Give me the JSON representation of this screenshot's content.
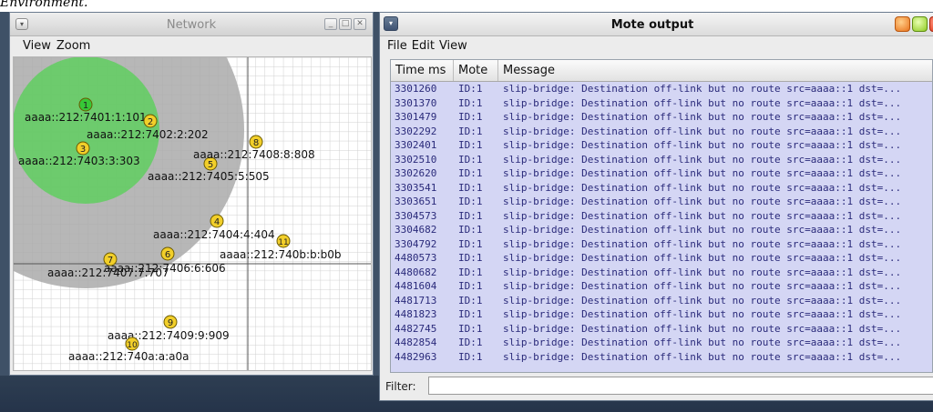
{
  "network": {
    "title": "Network",
    "menu": [
      "View",
      "Zoom"
    ],
    "motes": [
      {
        "id": "1",
        "color": "#37c837",
        "addr": "aaaa::212:7401:1:101"
      },
      {
        "id": "2",
        "color": "#f2cf2a",
        "addr": "aaaa::212:7402:2:202"
      },
      {
        "id": "3",
        "color": "#f2cf2a",
        "addr": "aaaa::212:7403:3:303"
      },
      {
        "id": "4",
        "color": "#f2cf2a",
        "addr": "aaaa::212:7404:4:404"
      },
      {
        "id": "5",
        "color": "#f2cf2a",
        "addr": "aaaa::212:7405:5:505"
      },
      {
        "id": "6",
        "color": "#f2cf2a",
        "addr": "aaaa::212:7406:6:606"
      },
      {
        "id": "7",
        "color": "#f2cf2a",
        "addr": "aaaa::212:7407:7:707"
      },
      {
        "id": "8",
        "color": "#f2cf2a",
        "addr": "aaaa::212:7408:8:808"
      },
      {
        "id": "9",
        "color": "#f2cf2a",
        "addr": "aaaa::212:7409:9:909"
      },
      {
        "id": "10",
        "color": "#f2cf2a",
        "addr": "aaaa::212:740a:a:a0a"
      },
      {
        "id": "11",
        "color": "#f2cf2a",
        "addr": "aaaa::212:740b:b:b0b"
      }
    ],
    "colors": {
      "tx_range": "#66cc66",
      "interference_range": "#aaaaaa"
    }
  },
  "mote_output": {
    "title": "Mote output",
    "menu": [
      "File",
      "Edit",
      "View"
    ],
    "columns": [
      "Time ms",
      "Mote",
      "Message"
    ],
    "rows": [
      {
        "time": "3301260",
        "mote": "ID:1",
        "message": "slip-bridge: Destination off-link but no route src=aaaa::1 dst=..."
      },
      {
        "time": "3301370",
        "mote": "ID:1",
        "message": "slip-bridge: Destination off-link but no route src=aaaa::1 dst=..."
      },
      {
        "time": "3301479",
        "mote": "ID:1",
        "message": "slip-bridge: Destination off-link but no route src=aaaa::1 dst=..."
      },
      {
        "time": "3302292",
        "mote": "ID:1",
        "message": "slip-bridge: Destination off-link but no route src=aaaa::1 dst=..."
      },
      {
        "time": "3302401",
        "mote": "ID:1",
        "message": "slip-bridge: Destination off-link but no route src=aaaa::1 dst=..."
      },
      {
        "time": "3302510",
        "mote": "ID:1",
        "message": "slip-bridge: Destination off-link but no route src=aaaa::1 dst=..."
      },
      {
        "time": "3302620",
        "mote": "ID:1",
        "message": "slip-bridge: Destination off-link but no route src=aaaa::1 dst=..."
      },
      {
        "time": "3303541",
        "mote": "ID:1",
        "message": "slip-bridge: Destination off-link but no route src=aaaa::1 dst=..."
      },
      {
        "time": "3303651",
        "mote": "ID:1",
        "message": "slip-bridge: Destination off-link but no route src=aaaa::1 dst=..."
      },
      {
        "time": "3304573",
        "mote": "ID:1",
        "message": "slip-bridge: Destination off-link but no route src=aaaa::1 dst=..."
      },
      {
        "time": "3304682",
        "mote": "ID:1",
        "message": "slip-bridge: Destination off-link but no route src=aaaa::1 dst=..."
      },
      {
        "time": "3304792",
        "mote": "ID:1",
        "message": "slip-bridge: Destination off-link but no route src=aaaa::1 dst=..."
      },
      {
        "time": "4480573",
        "mote": "ID:1",
        "message": "slip-bridge: Destination off-link but no route src=aaaa::1 dst=..."
      },
      {
        "time": "4480682",
        "mote": "ID:1",
        "message": "slip-bridge: Destination off-link but no route src=aaaa::1 dst=..."
      },
      {
        "time": "4481604",
        "mote": "ID:1",
        "message": "slip-bridge: Destination off-link but no route src=aaaa::1 dst=..."
      },
      {
        "time": "4481713",
        "mote": "ID:1",
        "message": "slip-bridge: Destination off-link but no route src=aaaa::1 dst=..."
      },
      {
        "time": "4481823",
        "mote": "ID:1",
        "message": "slip-bridge: Destination off-link but no route src=aaaa::1 dst=..."
      },
      {
        "time": "4482745",
        "mote": "ID:1",
        "message": "slip-bridge: Destination off-link but no route src=aaaa::1 dst=..."
      },
      {
        "time": "4482854",
        "mote": "ID:1",
        "message": "slip-bridge: Destination off-link but no route src=aaaa::1 dst=..."
      },
      {
        "time": "4482963",
        "mote": "ID:1",
        "message": "slip-bridge: Destination off-link but no route src=aaaa::1 dst=..."
      }
    ],
    "filter_label": "Filter:",
    "filter_value": ""
  },
  "window_controls": {
    "menu_glyph": "▾",
    "minimize_glyph": "_",
    "maximize_glyph": "□",
    "close_glyph": "✕"
  },
  "top_strip_text": "Environment."
}
